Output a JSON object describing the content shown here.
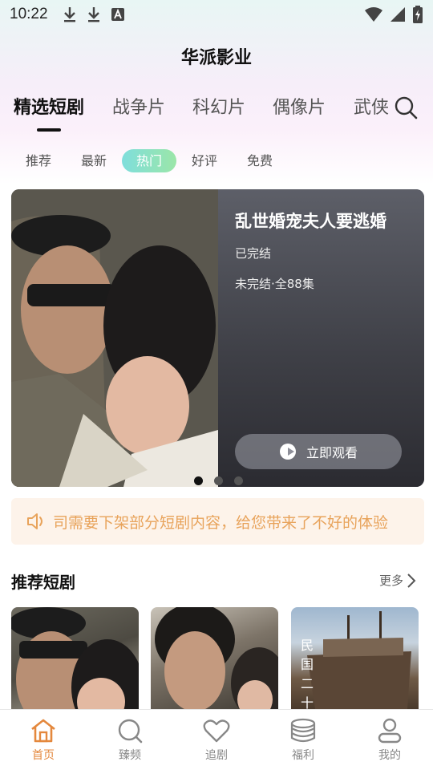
{
  "status_bar": {
    "time": "10:22",
    "left_icons": [
      "download-icon",
      "download-icon",
      "font-a-icon"
    ],
    "right_icons": [
      "wifi-icon",
      "cellular-icon",
      "battery-charging-icon"
    ]
  },
  "app": {
    "title": "华派影业"
  },
  "category_tabs": [
    {
      "label": "精选短剧",
      "active": true
    },
    {
      "label": "战争片",
      "active": false
    },
    {
      "label": "科幻片",
      "active": false
    },
    {
      "label": "偶像片",
      "active": false
    },
    {
      "label": "武侠",
      "active": false
    }
  ],
  "filters": [
    {
      "label": "推荐",
      "active": false
    },
    {
      "label": "最新",
      "active": false
    },
    {
      "label": "热门",
      "active": true
    },
    {
      "label": "好评",
      "active": false
    },
    {
      "label": "免费",
      "active": false
    }
  ],
  "banner": {
    "title": "乱世婚宠夫人要逃婚",
    "status": "已完结",
    "episodes": "未完结·全88集",
    "watch_label": "立即观看",
    "dots_count": 3,
    "active_dot": 0
  },
  "notice": {
    "text": "司需要下架部分短剧内容，给您带来了不好的体验"
  },
  "recommend": {
    "title": "推荐短剧",
    "more_label": "更多",
    "cards": [
      {
        "overlay_text": ""
      },
      {
        "overlay_text": ""
      },
      {
        "overlay_text": "民国二十"
      }
    ]
  },
  "bottom_nav": [
    {
      "label": "首页",
      "icon": "home-icon",
      "active": true
    },
    {
      "label": "臻频",
      "icon": "search-icon",
      "active": false
    },
    {
      "label": "追剧",
      "icon": "heart-icon",
      "active": false
    },
    {
      "label": "福利",
      "icon": "coins-icon",
      "active": false
    },
    {
      "label": "我的",
      "icon": "user-icon",
      "active": false
    }
  ],
  "colors": {
    "accent": "#e4883d",
    "filter_active_start": "#7fdedc",
    "filter_active_end": "#9be6a8",
    "notice_text": "#e8a35b",
    "notice_bg": "#fdf3ea"
  }
}
